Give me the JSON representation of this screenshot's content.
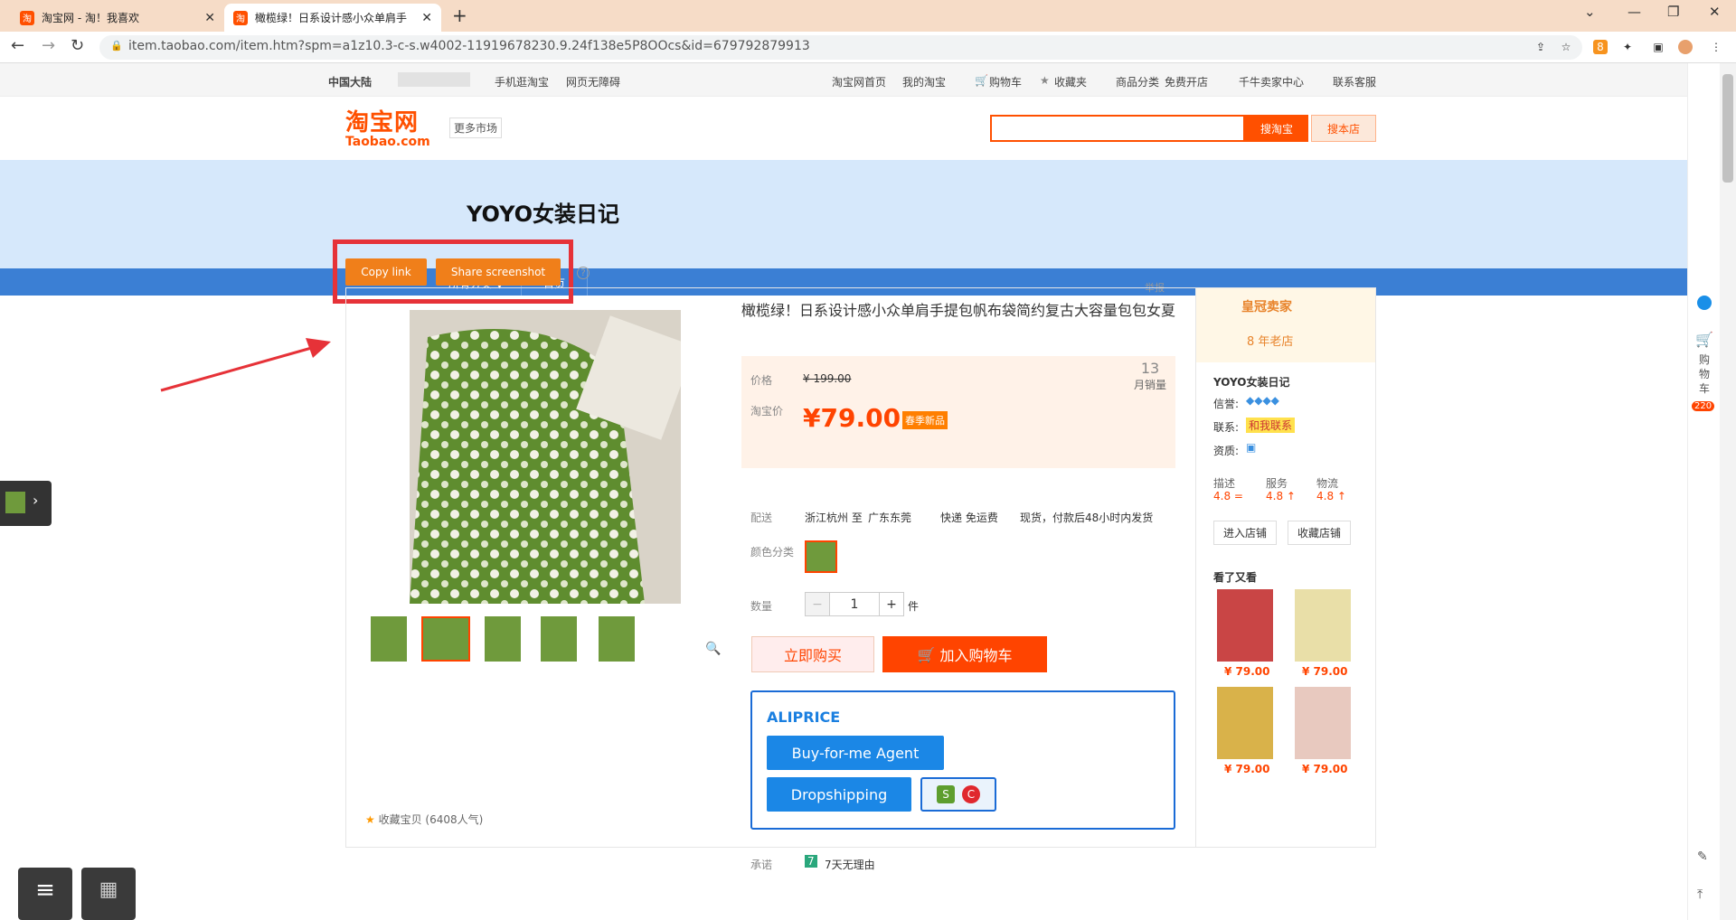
{
  "browser": {
    "tabs": [
      {
        "title": "淘宝网 - 淘！我喜欢",
        "active": false
      },
      {
        "title": "橄榄绿！日系设计感小众单肩手",
        "active": true
      }
    ],
    "url": "item.taobao.com/item.htm?spm=a1z10.3-c-s.w4002-11919678230.9.24f138e5P8OOcs&id=679792879913",
    "extension_badge": "8"
  },
  "site_nav": {
    "region": "中国大陆",
    "mobile": "手机逛淘宝",
    "accessible": "网页无障碍",
    "items": [
      "淘宝网首页",
      "我的淘宝",
      "购物车",
      "收藏夹",
      "商品分类",
      "免费开店",
      "千牛卖家中心",
      "联系客服"
    ]
  },
  "header": {
    "logo_cn": "淘宝网",
    "logo_en": "Taobao.com",
    "more_market": "更多市场",
    "search_placeholder": "",
    "search_btn": "搜淘宝",
    "shop_btn": "搜本店"
  },
  "shop": {
    "name": "YOYO女装日记",
    "nav_all": "所有分类 ▼",
    "nav_home": "首页"
  },
  "share": {
    "copy_link": "Copy link",
    "share_screenshot": "Share screenshot",
    "help": "?",
    "report": "举报"
  },
  "product": {
    "title": "橄榄绿！日系设计感小众单肩手提包帆布袋简约复古大容量包包女夏",
    "price_label": "价格",
    "original_price": "¥ 199.00",
    "tb_price_label": "淘宝价",
    "price": "¥79.00",
    "badge": "春季新品",
    "monthly_sales": "13",
    "monthly_sales_label": "月销量",
    "delivery_label": "配送",
    "delivery_from": "浙江杭州 至",
    "delivery_to": "广东东莞",
    "shipping": "快递 免运费",
    "ship_time": "现货，付款后48小时内发货",
    "color_label": "颜色分类",
    "qty_label": "数量",
    "qty": "1",
    "qty_unit": "件",
    "buy_now": "立即购买",
    "add_cart": "加入购物车",
    "favorite": "收藏宝贝 (6408人气)",
    "promise_label": "承诺",
    "promise": "7天无理由"
  },
  "aliprice": {
    "name": "ALIPRICE",
    "buy_agent": "Buy-for-me Agent",
    "dropshipping": "Dropshipping"
  },
  "seller": {
    "crown": "皇冠卖家",
    "years": "8 年老店",
    "name": "YOYO女装日记",
    "credit_label": "信誉:",
    "contact_label": "联系:",
    "contact_btn": "和我联系",
    "qual_label": "资质:",
    "desc_label": "描述",
    "desc_score": "4.8 =",
    "service_label": "服务",
    "service_score": "4.8 ↑",
    "logistics_label": "物流",
    "logistics_score": "4.8 ↑",
    "enter_shop": "进入店铺",
    "fav_shop": "收藏店铺",
    "seen_title": "看了又看",
    "seen_prices": [
      "¥ 79.00",
      "¥ 79.00",
      "¥ 79.00",
      "¥ 79.00"
    ]
  },
  "right_tool": {
    "cart_label": "购物车",
    "cart_count": "220"
  }
}
